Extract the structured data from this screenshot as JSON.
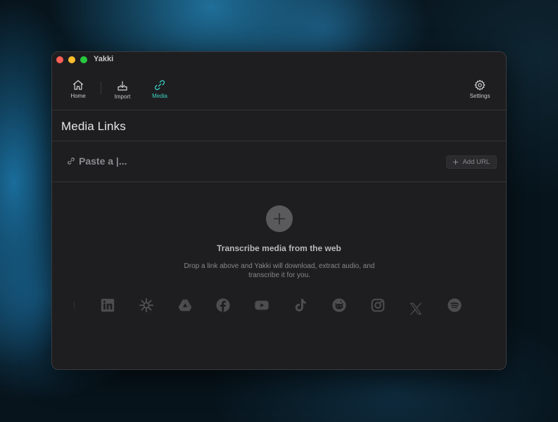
{
  "window": {
    "title": "Yakki"
  },
  "toolbar": {
    "items": [
      {
        "label": "Home",
        "icon": "house-icon",
        "active": false
      },
      {
        "label": "Import",
        "icon": "tray-download-icon",
        "active": false
      },
      {
        "label": "Media",
        "icon": "link-icon",
        "active": true
      }
    ],
    "settings": {
      "label": "Settings",
      "icon": "gear-icon"
    }
  },
  "colors": {
    "accent": "#3bd1c4",
    "background": "#1e1e20"
  },
  "section": {
    "title": "Media Links"
  },
  "url_input": {
    "placeholder": "Paste a |...",
    "value": ""
  },
  "add_url": {
    "label": "Add URL"
  },
  "empty_state": {
    "title": "Transcribe media from the web",
    "description": "Drop a link above and Yakki will download, extract audio, and transcribe it for you."
  },
  "platforms": [
    "LinkedIn",
    "Perplexity",
    "Google Drive",
    "Facebook",
    "YouTube",
    "TikTok",
    "Reddit",
    "Instagram",
    "X",
    "Spotify"
  ]
}
